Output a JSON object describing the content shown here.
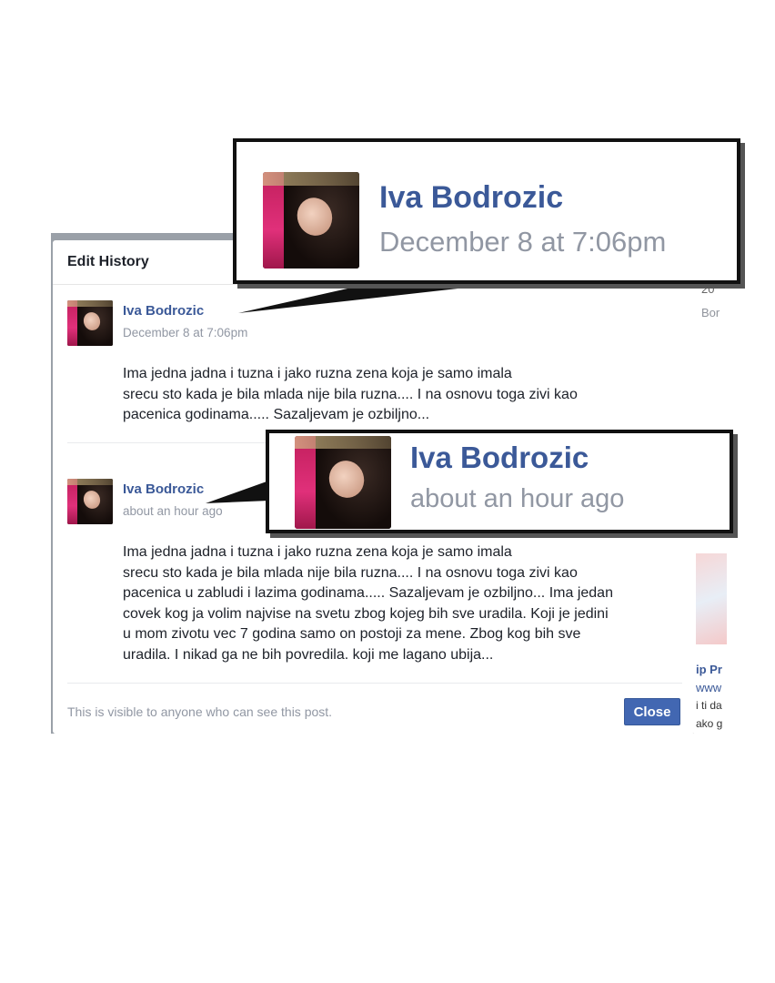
{
  "dialog": {
    "title": "Edit History",
    "entries": [
      {
        "name": "Iva Bodrozic",
        "time": "December 8 at 7:06pm",
        "lines": [
          "Ima jedna jadna i tuzna i jako ruzna zena koja je samo imala",
          "srecu sto kada je bila mlada nije bila ruzna.... I na osnovu toga zivi kao",
          "pacenica godinama..... Sazaljevam je ozbiljno..."
        ]
      },
      {
        "name": "Iva Bodrozic",
        "time": "about an hour ago",
        "lines": [
          "Ima jedna jadna i tuzna i jako ruzna zena koja je samo imala",
          "srecu sto kada je bila mlada nije bila ruzna.... I na osnovu toga zivi kao",
          "pacenica u zabludi i lazima godinama..... Sazaljevam je ozbiljno... Ima jedan",
          "covek kog ja volim najvise na svetu zbog kojeg bih sve uradila. Koji je jedini",
          "u mom zivotu vec 7 godina samo on postoji za mene. Zbog kog bih sve",
          "uradila. I nikad ga ne bih povredila. koji me lagano ubija..."
        ]
      }
    ],
    "footer_note": "This is visible to anyone who can see this post.",
    "close_label": "Close"
  },
  "callouts": [
    {
      "name": "Iva Bodrozic",
      "time": "December 8 at 7:06pm"
    },
    {
      "name": "Iva Bodrozic",
      "time": "about an hour ago"
    }
  ],
  "background": {
    "right_column": [
      "20",
      "Bor",
      "ip Pr",
      "www",
      "i ti da",
      "ako g"
    ]
  },
  "colors": {
    "link_blue": "#3b5998",
    "timestamp_gray": "#9197a3",
    "button_blue": "#4267b2"
  }
}
